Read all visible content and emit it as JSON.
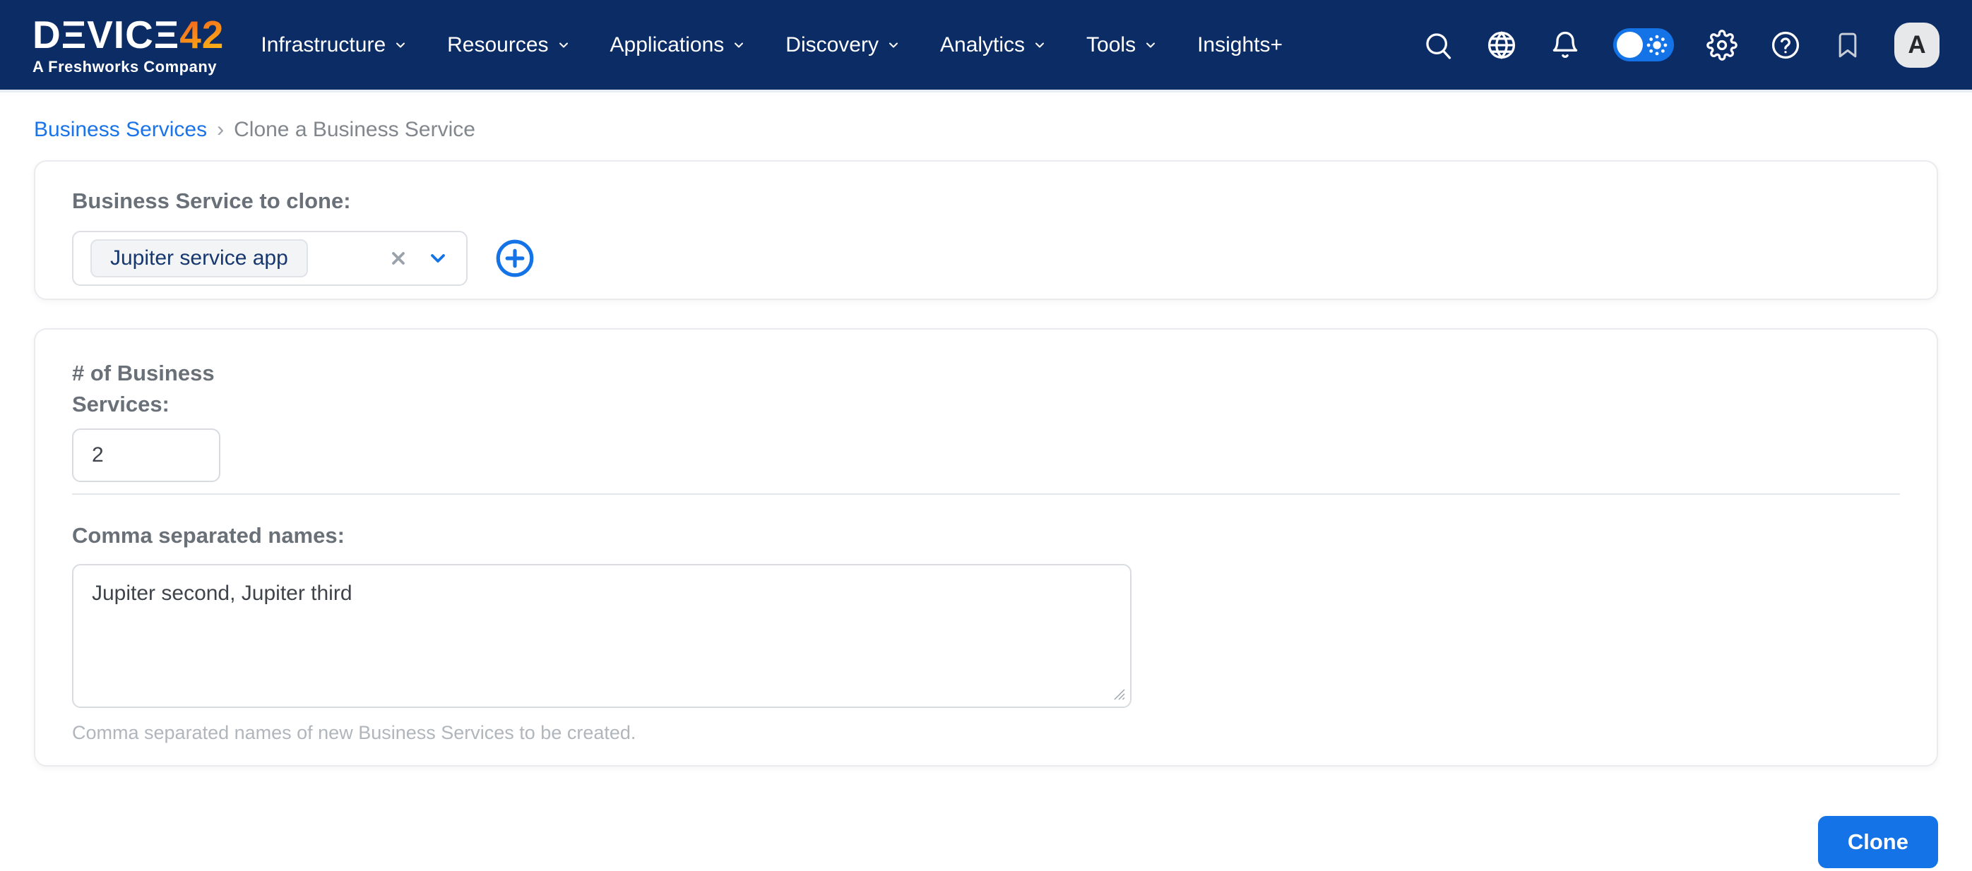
{
  "nav": {
    "logo": {
      "brand_display": "DΞVICΞ",
      "brand_number": "42",
      "tagline": "A Freshworks Company"
    },
    "menu": [
      {
        "label": "Infrastructure",
        "has_dropdown": true
      },
      {
        "label": "Resources",
        "has_dropdown": true
      },
      {
        "label": "Applications",
        "has_dropdown": true
      },
      {
        "label": "Discovery",
        "has_dropdown": true
      },
      {
        "label": "Analytics",
        "has_dropdown": true
      },
      {
        "label": "Tools",
        "has_dropdown": true
      },
      {
        "label": "Insights+",
        "has_dropdown": false
      }
    ],
    "icons": [
      "search-icon",
      "globe-icon",
      "bell-icon",
      "theme-toggle",
      "gear-icon",
      "help-icon",
      "bookmark-icon"
    ],
    "theme_toggle_state": "light",
    "avatar_initial": "A"
  },
  "breadcrumb": {
    "link": "Business Services",
    "separator": "›",
    "current": "Clone a Business Service"
  },
  "clone_card": {
    "label": "Business Service to clone:",
    "selected_chip": "Jupiter service app",
    "controls": [
      "clear-icon",
      "chevron-down-icon",
      "add-circle-icon"
    ]
  },
  "form_card": {
    "count_label": "# of Business Services:",
    "count_value": "2",
    "names_label": "Comma separated names:",
    "names_value": "Jupiter second, Jupiter third",
    "names_help": "Comma separated names of new Business Services to be created."
  },
  "actions": {
    "clone_label": "Clone"
  },
  "colors": {
    "navy": "#0c2c66",
    "accent": "#1473e6",
    "link": "#1a73e8",
    "logo_gradient_start": "#f3641d",
    "logo_gradient_end": "#fcb315",
    "chip_bg": "#f3f4f6",
    "label_gray": "#697078",
    "help_gray": "#b0b6bc"
  }
}
